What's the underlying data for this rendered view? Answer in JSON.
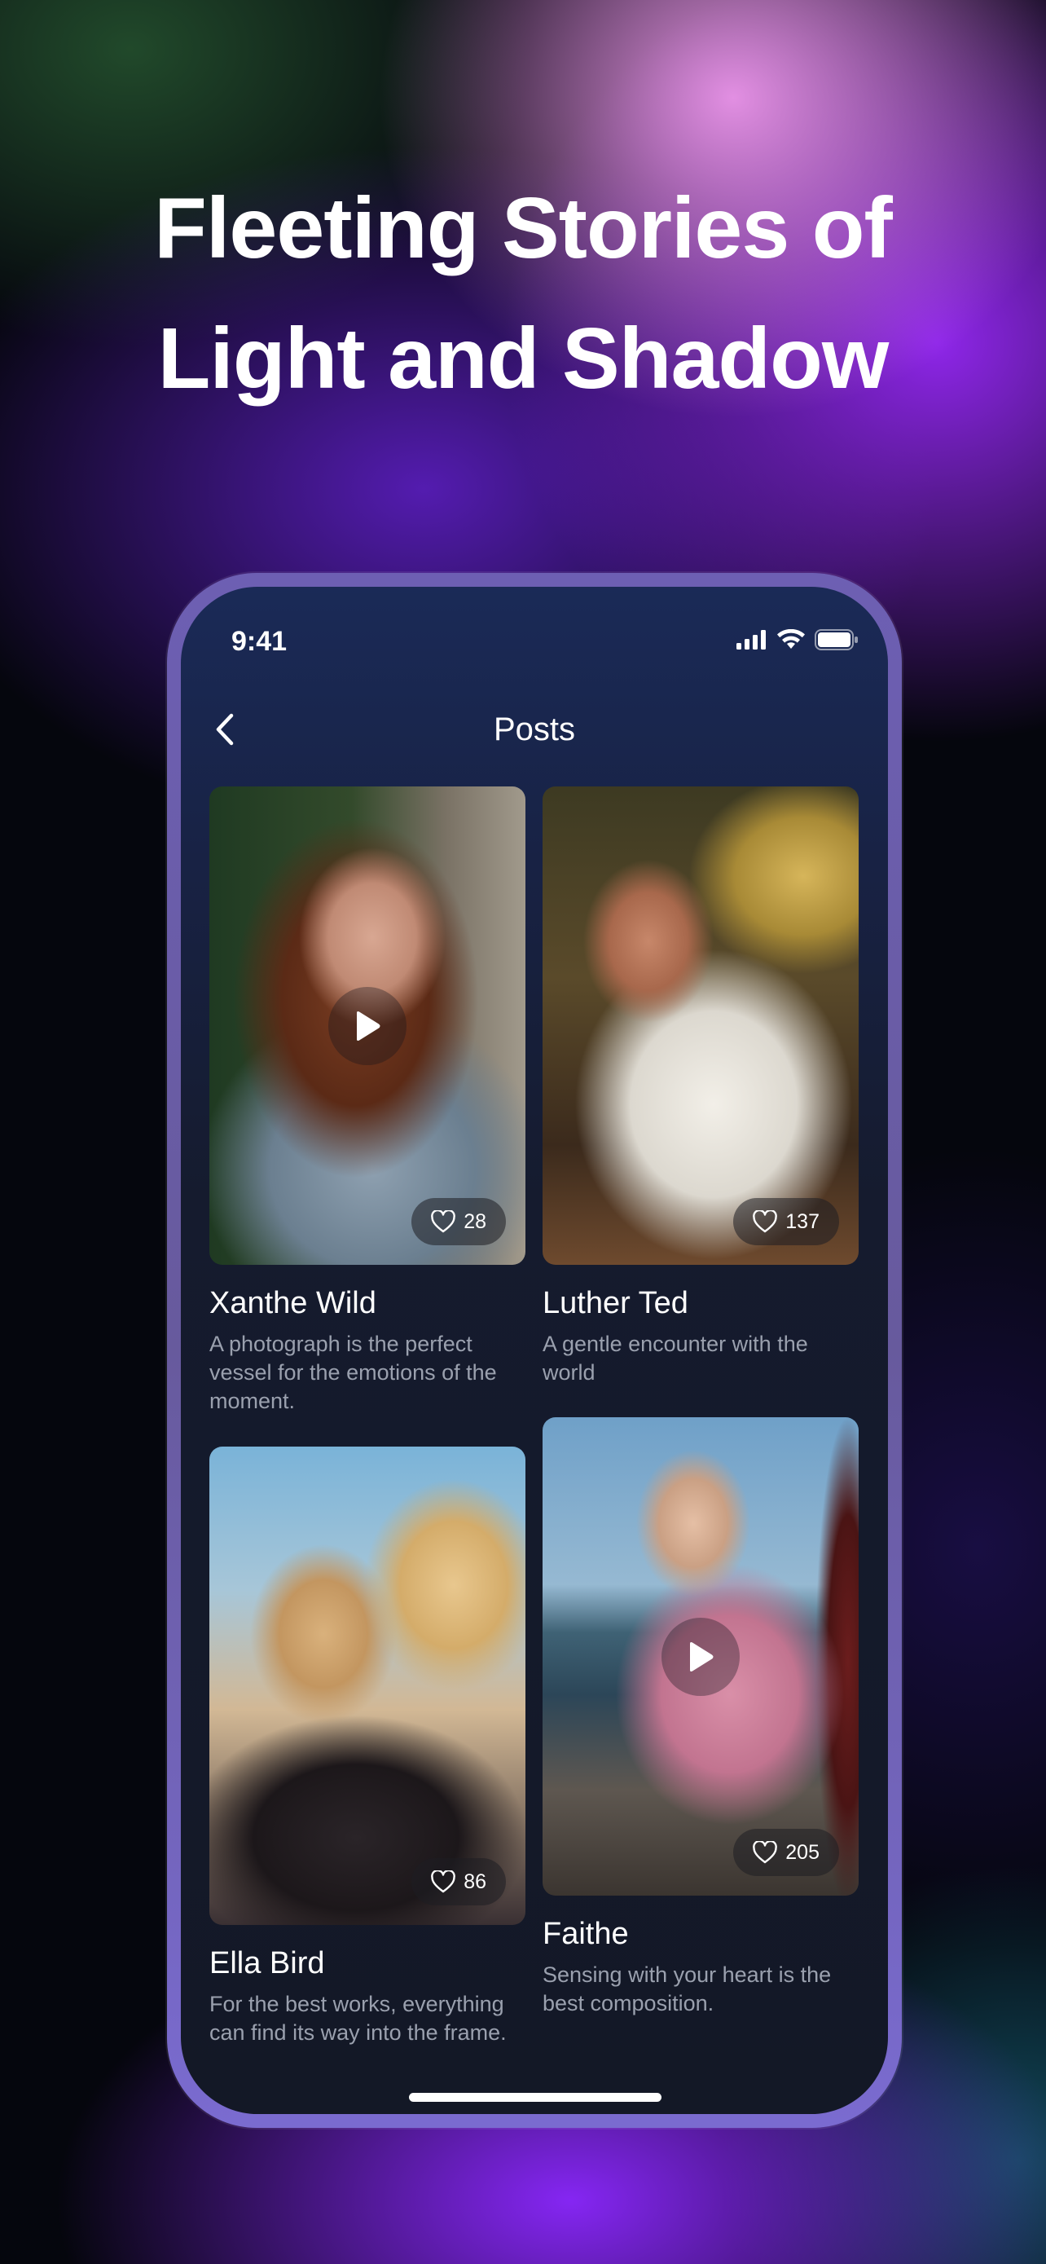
{
  "headline": {
    "line1": "Fleeting Stories of",
    "line2": "Light and Shadow"
  },
  "status_bar": {
    "time": "9:41",
    "icons": [
      "cellular-signal-icon",
      "wifi-icon",
      "battery-icon"
    ]
  },
  "nav": {
    "back_icon": "chevron-left-icon",
    "title": "Posts"
  },
  "posts": [
    {
      "name": "Xanthe Wild",
      "description": "A photograph is the perfect vessel for the emotions of the moment.",
      "likes": "28",
      "has_video": true
    },
    {
      "name": "Luther Ted",
      "description": "A gentle encounter with the world",
      "likes": "137",
      "has_video": false
    },
    {
      "name": "Ella Bird",
      "description": "For the best works, everything can find its way into the frame.",
      "likes": "86",
      "has_video": false
    },
    {
      "name": "Faithe",
      "description": "Sensing with your heart is the best composition.",
      "likes": "205",
      "has_video": true
    }
  ],
  "colors": {
    "accent_purple": "#8a2cf0",
    "screen_bg": "#151b2e",
    "text_secondary": "#9aa0ae"
  }
}
